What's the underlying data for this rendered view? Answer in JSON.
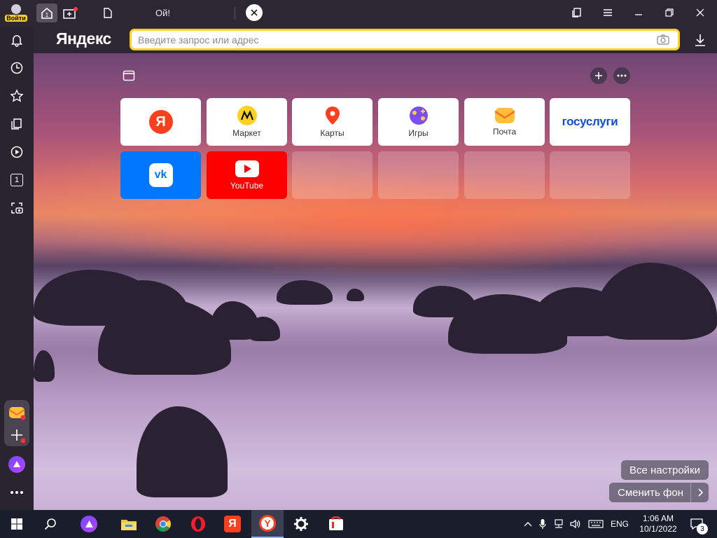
{
  "login": {
    "label": "Войти"
  },
  "tab": {
    "title": "Ой!"
  },
  "brand": {
    "logo": "Яндекс"
  },
  "search": {
    "placeholder": "Введите запрос или адрес",
    "value": ""
  },
  "tiles": [
    {
      "label": "",
      "icon": "yandex-logo-icon"
    },
    {
      "label": "Маркет",
      "icon": "market-icon"
    },
    {
      "label": "Карты",
      "icon": "maps-pin-icon"
    },
    {
      "label": "Игры",
      "icon": "games-icon"
    },
    {
      "label": "Почта",
      "icon": "mail-icon"
    },
    {
      "label": "госуслуги",
      "icon": "gosuslugi-logo"
    },
    {
      "label": "",
      "icon": "vk-icon"
    },
    {
      "label": "YouTube",
      "icon": "youtube-icon"
    }
  ],
  "sidebar": {
    "tab_counter": "1"
  },
  "tabs_counter": "1",
  "buttons": {
    "settings": "Все настройки",
    "change_bg": "Сменить фон"
  },
  "taskbar": {
    "lang": "ENG",
    "time": "1:06 AM",
    "date": "10/1/2022",
    "notifications": "3"
  },
  "colors": {
    "accent": "#ffd21f",
    "yandex_red": "#fc3f1d",
    "vk": "#0077ff",
    "youtube": "#ff0000"
  }
}
